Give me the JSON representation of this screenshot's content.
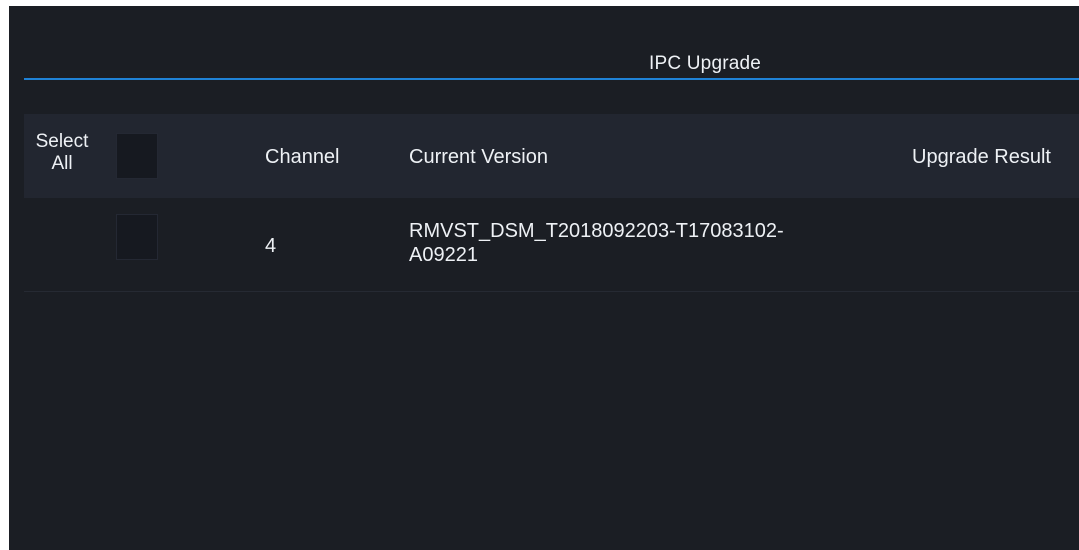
{
  "window": {
    "title": "IPC Upgrade"
  },
  "table": {
    "select_all_label_line1": "Select",
    "select_all_label_line2": "All",
    "columns": {
      "channel": "Channel",
      "current_version": "Current Version",
      "upgrade_result": "Upgrade Result"
    },
    "rows": [
      {
        "selected": false,
        "channel": "4",
        "current_version_line1": "RMVST_DSM_T2018092203-T17083102-",
        "current_version_line2": "A09221",
        "upgrade_result": ""
      }
    ],
    "select_all_checked": false
  },
  "colors": {
    "background": "#1b1e24",
    "header_background": "#222630",
    "accent_line": "#1f82d6",
    "text": "#eef1f5"
  }
}
